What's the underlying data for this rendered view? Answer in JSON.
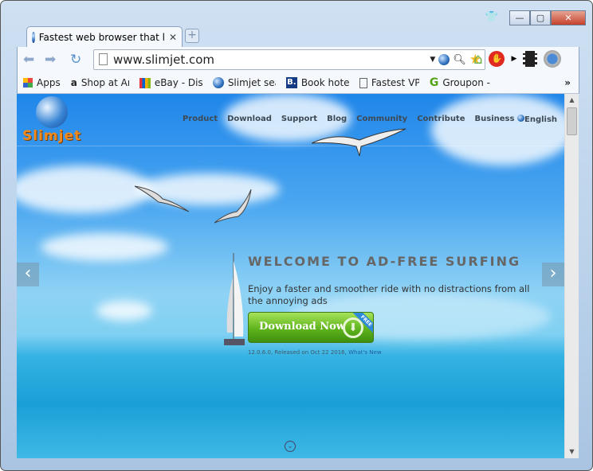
{
  "window": {
    "minimize": "—",
    "maximize": "▢",
    "close": "✕"
  },
  "tab": {
    "title": "Fastest web browser that l",
    "close": "✕",
    "new_tab": "+"
  },
  "toolbar": {
    "url": "www.slimjet.com"
  },
  "bookmarks": [
    {
      "label": "Apps",
      "icon": "apps-grid-icon"
    },
    {
      "label": "Shop at Am",
      "icon": "amazon-icon"
    },
    {
      "label": "eBay - Disc",
      "icon": "ebay-icon"
    },
    {
      "label": "Slimjet sea",
      "icon": "globe-icon"
    },
    {
      "label": "Book hotel",
      "icon": "booking-icon"
    },
    {
      "label": "Fastest VPN",
      "icon": "page-icon"
    },
    {
      "label": "Groupon -",
      "icon": "groupon-icon"
    }
  ],
  "bookmarks_more": "»",
  "site": {
    "logo": "Slimjet",
    "menu": [
      "Product",
      "Download",
      "Support",
      "Blog",
      "Community",
      "Contribute",
      "Business"
    ],
    "language": "English",
    "hero_title": "WELCOME TO AD-FREE SURFING",
    "hero_subtitle": "Enjoy a faster and smoother ride with no distractions from all the annoying ads",
    "download_label": "Download Now",
    "free_badge": "FREE",
    "version_text": "12.0.6.0, Released on Oct 22 2016,",
    "whats_new": "What's New"
  },
  "colors": {
    "download_green": "#5fb41c",
    "logo_orange": "#f08a1c",
    "sky_blue": "#1f86ea"
  }
}
